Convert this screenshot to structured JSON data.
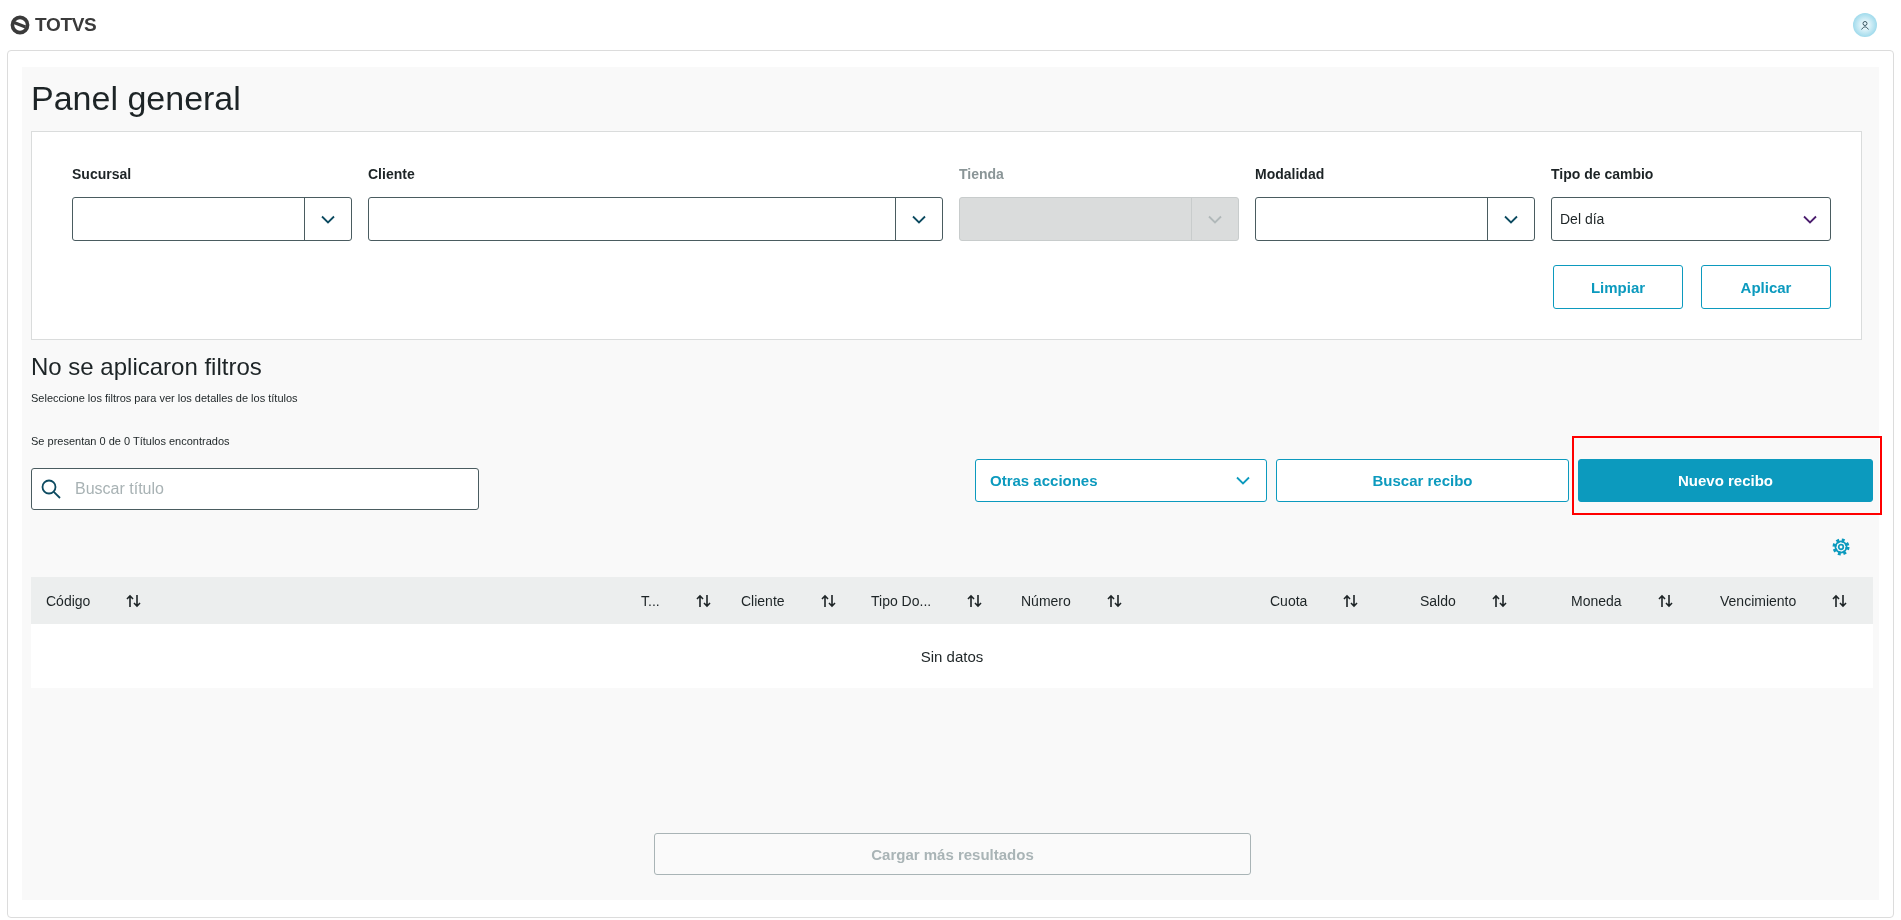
{
  "header": {
    "brand": "TOTVS"
  },
  "page": {
    "title": "Panel general"
  },
  "filters": [
    {
      "label": "Sucursal",
      "kind": "combo",
      "disabled": false
    },
    {
      "label": "Cliente",
      "kind": "combo",
      "disabled": false
    },
    {
      "label": "Tienda",
      "kind": "combo",
      "disabled": true
    },
    {
      "label": "Modalidad",
      "kind": "combo",
      "disabled": false
    },
    {
      "label": "Tipo de cambio",
      "kind": "select",
      "value": "Del día",
      "disabled": false
    }
  ],
  "filter_buttons": [
    "Limpiar",
    "Aplicar"
  ],
  "status": {
    "title": "No se aplicaron filtros",
    "subtitle": "Seleccione los filtros para ver los detalles de los títulos"
  },
  "count_text": "Se presentan 0 de 0 Títulos encontrados",
  "search": {
    "placeholder": "Buscar título"
  },
  "actions": [
    {
      "label": "Otras acciones",
      "kind": "dropdown",
      "highlighted": false
    },
    {
      "label": "Buscar recibo",
      "kind": "secondary",
      "highlighted": false
    },
    {
      "label": "Nuevo recibo",
      "kind": "primary",
      "highlighted": true
    }
  ],
  "table": {
    "columns": [
      {
        "label": "Código"
      },
      {
        "label": "T..."
      },
      {
        "label": "Cliente"
      },
      {
        "label": "Tipo Do..."
      },
      {
        "label": "Número"
      },
      {
        "label": "Cuota"
      },
      {
        "label": "Saldo"
      },
      {
        "label": "Moneda"
      },
      {
        "label": "Vencimiento"
      }
    ],
    "empty_text": "Sin datos"
  },
  "load_more": {
    "label": "Cargar más resultados",
    "disabled": true
  }
}
